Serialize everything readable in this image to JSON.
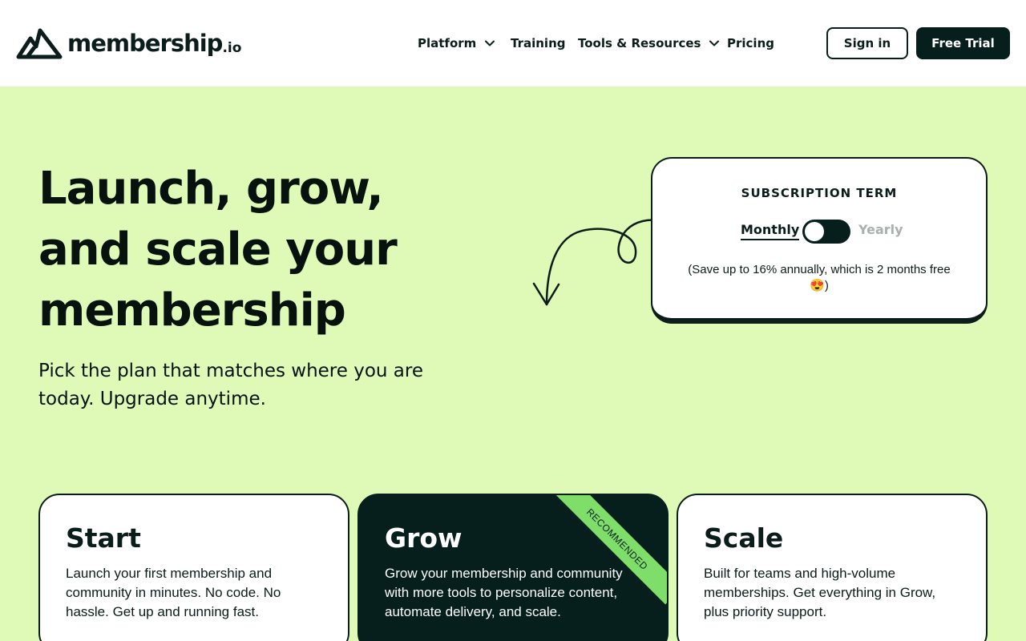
{
  "header": {
    "logo_text": "membership",
    "logo_tld": ".io",
    "nav": {
      "platform": "Platform",
      "training": "Training",
      "tools": "Tools & Resources",
      "pricing": "Pricing"
    },
    "sign_in": "Sign in",
    "free_trial": "Free Trial"
  },
  "hero": {
    "title": "Launch, grow, and scale your membership",
    "subtitle": "Pick the plan that matches where you are today. Upgrade anytime."
  },
  "subscription": {
    "title": "SUBSCRIPTION TERM",
    "monthly": "Monthly",
    "yearly": "Yearly",
    "selected": "Monthly",
    "note": "(Save up to 16% annually, which is 2 months free 😍)"
  },
  "plans": [
    {
      "name": "Start",
      "description": "Launch your first membership and community in minutes. No code. No hassle. Get up and running fast."
    },
    {
      "name": "Grow",
      "description": "Grow your membership and community with more tools to personalize content, automate delivery, and scale.",
      "badge": "RECOMMENDED"
    },
    {
      "name": "Scale",
      "description": "Built for teams and high-volume memberships. Get everything in Grow, plus priority support."
    }
  ],
  "colors": {
    "background": "#dffab6",
    "dark": "#061f1c",
    "accent_green": "#7fdd6a"
  }
}
